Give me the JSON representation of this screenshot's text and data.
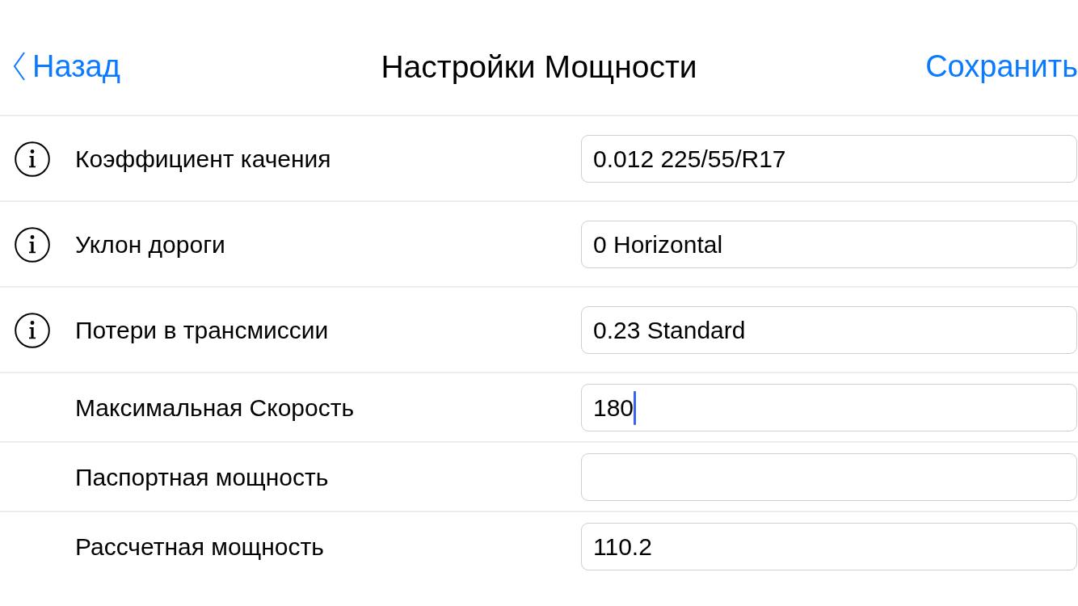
{
  "nav_bar": {
    "back_button": "Назад",
    "title": "Настройки Мощности",
    "save_button": "Сохранить"
  },
  "rows": [
    {
      "label": "Коэффициент качения",
      "info": true,
      "value": "0.012 225/55/R17",
      "focused": false
    },
    {
      "label": "Уклон дороги",
      "info": true,
      "value": "0 Horizontal",
      "focused": false
    },
    {
      "label": "Потери в трансмиссии",
      "info": true,
      "value": "0.23 Standard",
      "focused": false
    },
    {
      "label": "Максимальная Скорость",
      "info": false,
      "value": "180",
      "focused": true
    },
    {
      "label": "Паспортная мощность",
      "info": false,
      "focused": false
    },
    {
      "label": "Рассчетная мощность",
      "info": false,
      "value": "110.2",
      "focused": false
    }
  ]
}
